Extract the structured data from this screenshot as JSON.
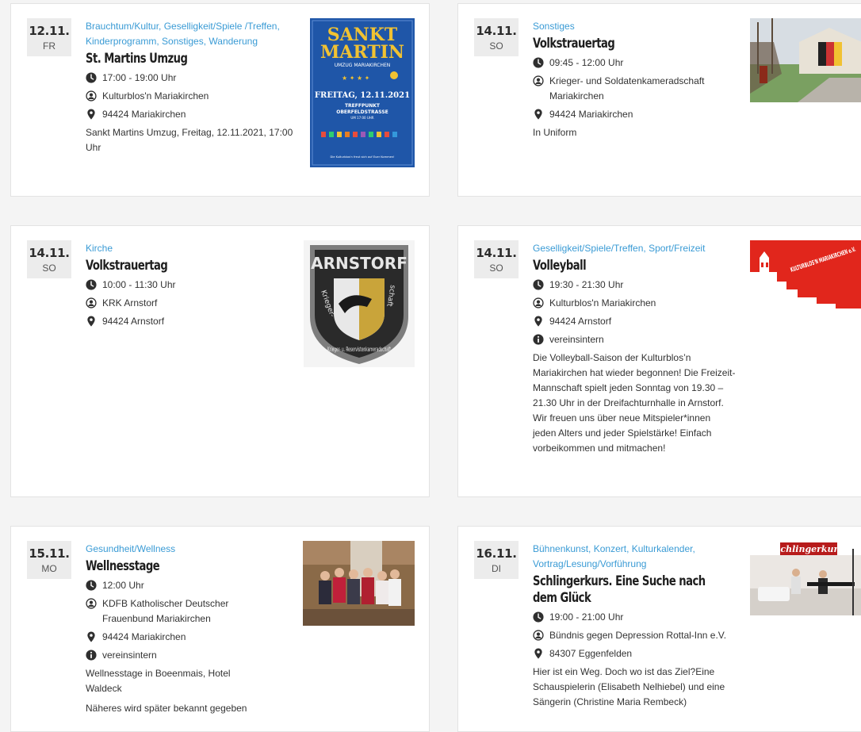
{
  "events": [
    {
      "date": "12.11.",
      "weekday": "FR",
      "categories": "Brauchtum/Kultur, Geselligkeit/Spiele /Treffen, Kinderprogramm, Sonstiges, Wanderung",
      "title": "St. Martins Umzug",
      "time": "17:00 - 19:00 Uhr",
      "organizer": "Kulturblos'n Mariakirchen",
      "location": "94424 Mariakirchen",
      "info": "",
      "description": "Sankt Martins Umzug, Freitag, 12.11.2021, 17:00 Uhr",
      "poster": {
        "line1": "SANKT",
        "line2": "MARTIN",
        "line3": "UMZUG MARIAKIRCHEN",
        "line4": "FREITAG, 12.11.2021",
        "line5": "TREFFPUNKT",
        "line6": "OBERFELDSTRASSE",
        "line7": "UM 17:00 UHR",
        "footer": "Die Kulturblos'n freut sich auf Euer Kommen!"
      }
    },
    {
      "date": "14.11.",
      "weekday": "SO",
      "categories": "Sonstiges",
      "title": "Volkstrauertag",
      "time": "09:45 - 12:00 Uhr",
      "organizer": "Krieger- und Soldatenkameradschaft Mariakirchen",
      "location": "94424 Mariakirchen",
      "info": "",
      "description": "In Uniform"
    },
    {
      "date": "14.11.",
      "weekday": "SO",
      "categories": "Kirche",
      "title": "Volkstrauertag",
      "time": "10:00 - 11:30 Uhr",
      "organizer": "KRK Arnstorf",
      "location": "94424 Arnstorf",
      "info": "",
      "description": "",
      "patch": {
        "top": "ARNSTORF",
        "ring": "Krieger- u. Reservistenkameradschaft"
      }
    },
    {
      "date": "14.11.",
      "weekday": "SO",
      "categories": "Geselligkeit/Spiele/Treffen, Sport/Freizeit",
      "title": "Volleyball",
      "time": "19:30 - 21:30 Uhr",
      "organizer": "Kulturblos'n Mariakirchen",
      "location": "94424 Arnstorf",
      "info": "vereinsintern",
      "description": "Die Volleyball-Saison der Kulturblos’n Mariakirchen hat wieder begonnen! Die Freizeit-Mannschaft spielt jeden Sonntag von 19.30 – 21.30 Uhr in der Dreifachturnhalle in Arnstorf. Wir freuen uns über neue Mitspieler*innen jeden Alters und jeder Spielstärke! Einfach vorbeikommen und mitmachen!",
      "logo": {
        "text": "KULTURBLOS'N MARIAKIRCHEN e.V."
      }
    },
    {
      "date": "15.11.",
      "weekday": "MO",
      "categories": "Gesundheit/Wellness",
      "title": "Wellnesstage",
      "time": "12:00 Uhr",
      "organizer": "KDFB Katholischer Deutscher Frauenbund Mariakirchen",
      "location": "94424 Mariakirchen",
      "info": "vereinsintern",
      "description": "Wellnesstage in Boeenmais, Hotel Waldeck",
      "description2": "Näheres wird später bekannt gegeben"
    },
    {
      "date": "16.11.",
      "weekday": "DI",
      "categories": "Bühnenkunst, Konzert, Kulturkalender, Vortrag/Lesung/Vorführung",
      "title": "Schlingerkurs. Eine Suche nach dem Glück",
      "time": "19:00 - 21:00 Uhr",
      "organizer": "Bündnis gegen Depression Rottal-Inn e.V.",
      "location": "84307 Eggenfelden",
      "info": "",
      "description": "Hier ist ein Weg. Doch wo ist das Ziel?Eine Schauspielerin (Elisabeth Nelhiebel) und eine Sängerin (Christine Maria Rembeck)",
      "banner": {
        "text": "Schlingerkurs"
      }
    }
  ],
  "icons": {
    "clock": "clock-icon",
    "organizer": "user-circle-icon",
    "location": "map-pin-icon",
    "info": "info-circle-icon"
  },
  "colors": {
    "accent": "#3a9bd5",
    "poster_blue": "#1f56a8",
    "poster_gold": "#f1c232",
    "logo_red": "#e1261c",
    "date_bg": "#ececec"
  }
}
